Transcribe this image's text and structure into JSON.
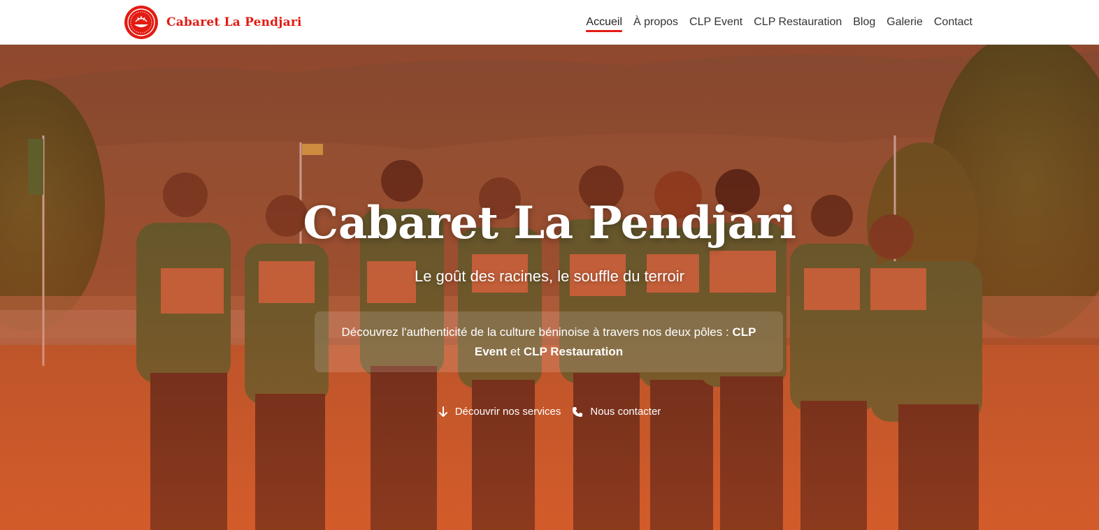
{
  "brand": {
    "name": "Cabaret La Pendjari",
    "color": "#e31b13"
  },
  "nav": {
    "items": [
      {
        "label": "Accueil",
        "active": true
      },
      {
        "label": "À propos",
        "active": false
      },
      {
        "label": "CLP Event",
        "active": false
      },
      {
        "label": "CLP Restauration",
        "active": false
      },
      {
        "label": "Blog",
        "active": false
      },
      {
        "label": "Galerie",
        "active": false
      },
      {
        "label": "Contact",
        "active": false
      }
    ]
  },
  "hero": {
    "title": "Cabaret La Pendjari",
    "subtitle": "Le goût des racines, le souffle du terroir",
    "intro_text": "Découvrez l'authenticité de la culture béninoise à travers nos deux pôles :",
    "intro_pole_1": "CLP Event",
    "intro_connector": "et",
    "intro_pole_2": "CLP Restauration",
    "actions": {
      "services_label": "Découvrir nos services",
      "services_icon": "arrow-down-icon",
      "contact_label": "Nous contacter",
      "contact_icon": "phone-icon"
    }
  }
}
